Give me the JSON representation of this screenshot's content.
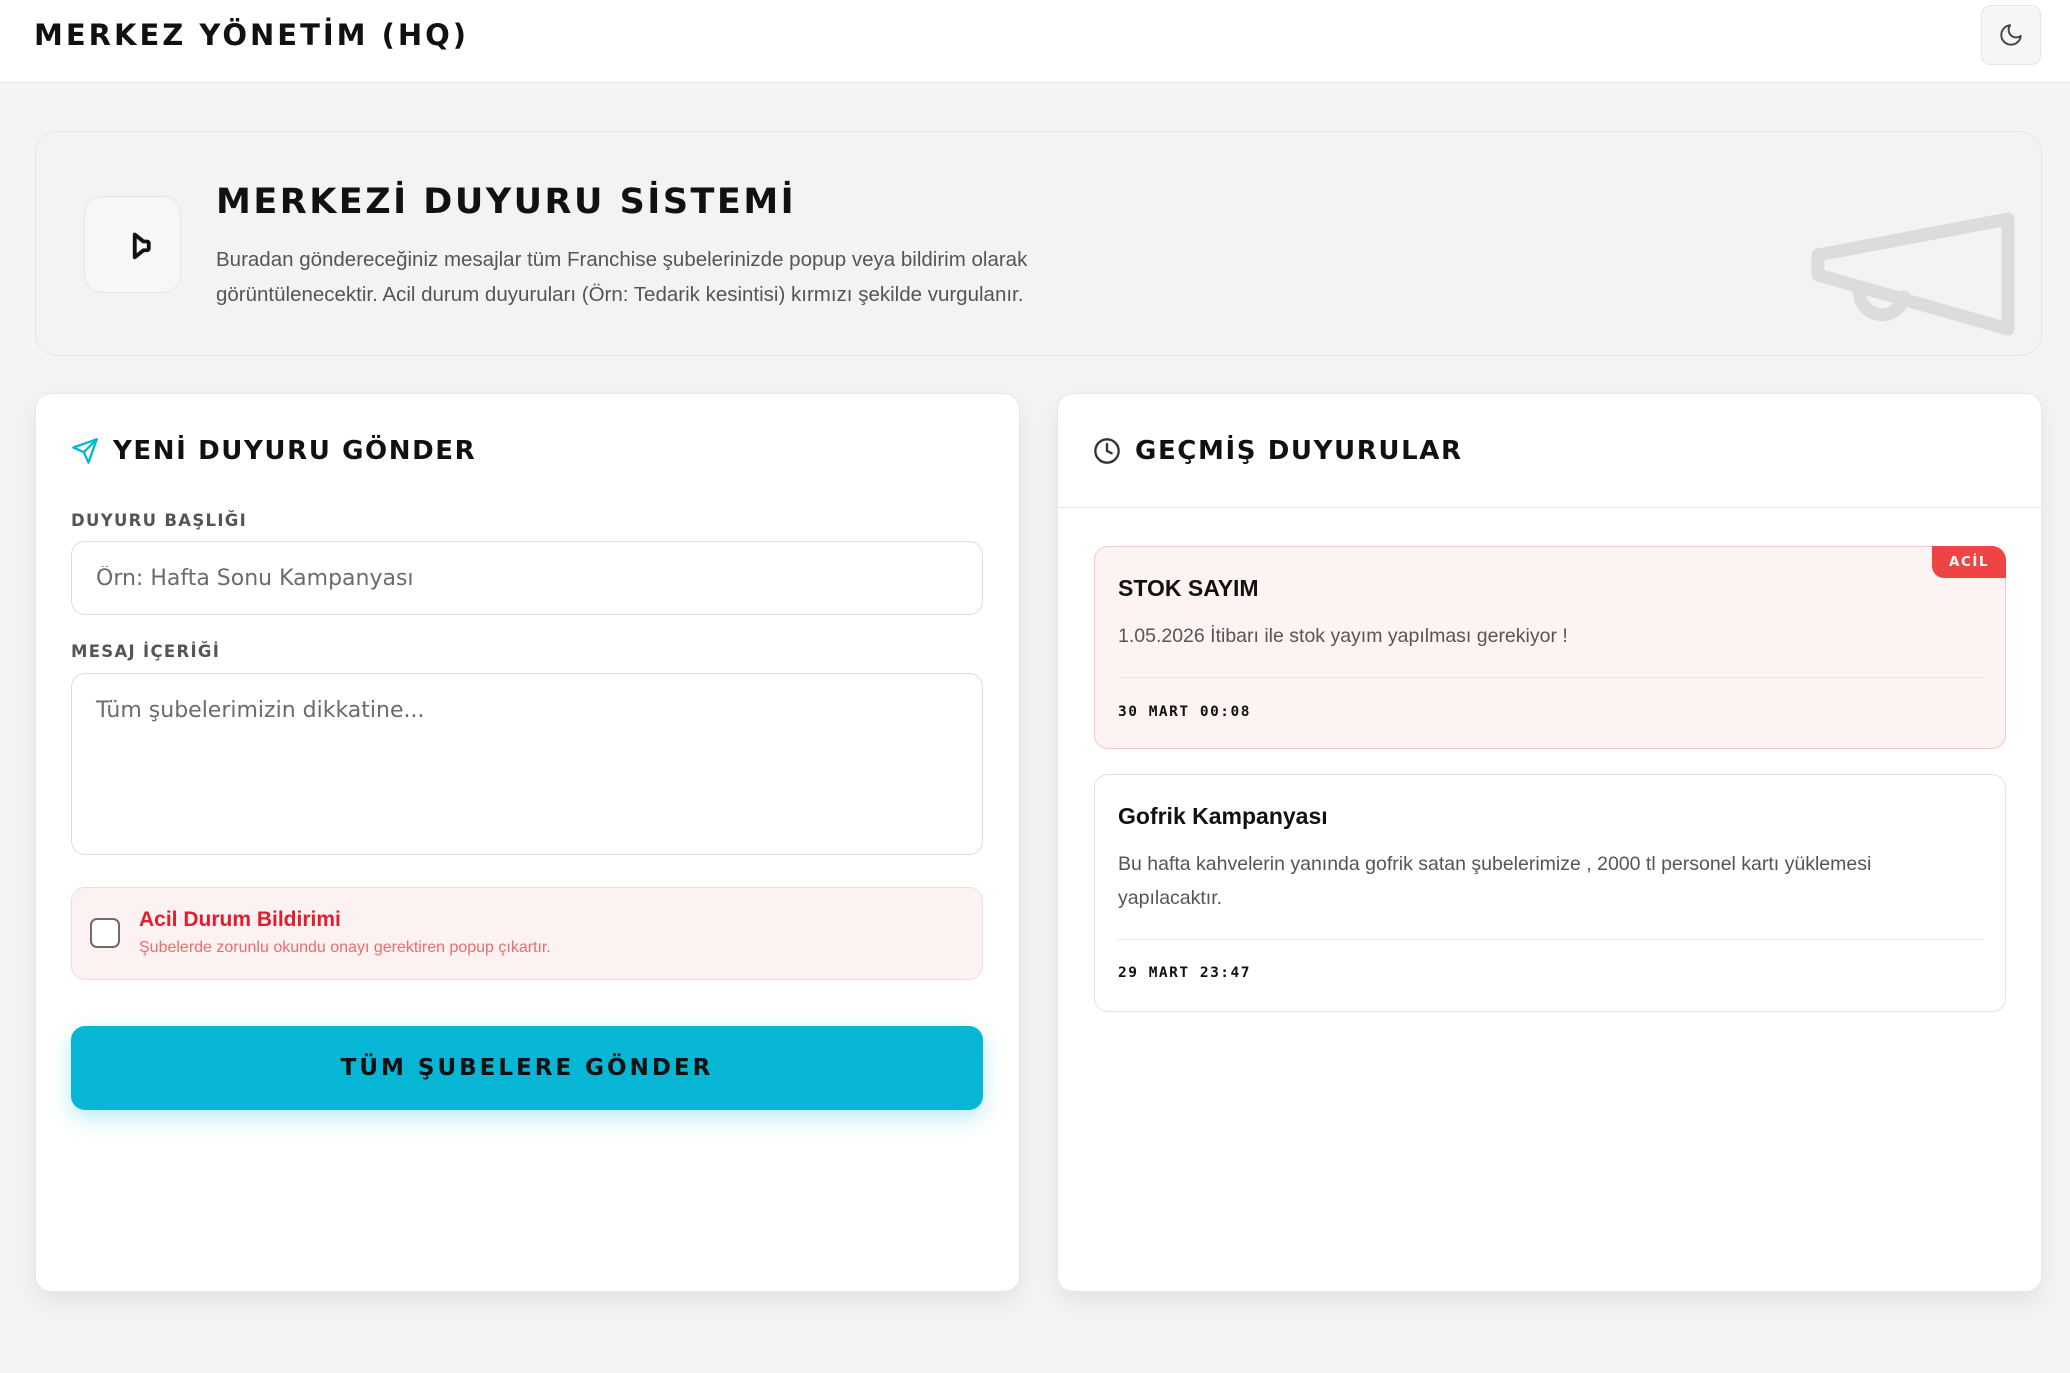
{
  "header": {
    "title": "MERKEZ YÖNETİM (HQ)",
    "theme_toggle_icon": "moon-icon"
  },
  "hero": {
    "icon": "megaphone-icon",
    "title": "MERKEZİ DUYURU SİSTEMİ",
    "description": "Buradan göndereceğiniz mesajlar tüm Franchise şubelerinizde popup veya bildirim olarak görüntülenecektir. Acil durum duyuruları (Örn: Tedarik kesintisi) kırmızı şekilde vurgulanır."
  },
  "form": {
    "title": "YENİ DUYURU GÖNDER",
    "title_icon": "send-icon",
    "subject_label": "DUYURU BAŞLIĞI",
    "subject_placeholder": "Örn: Hafta Sonu Kampanyası",
    "subject_value": "",
    "message_label": "MESAJ İÇERİĞİ",
    "message_placeholder": "Tüm şubelerimizin dikkatine...",
    "message_value": "",
    "urgent": {
      "checked": false,
      "title": "Acil Durum Bildirimi",
      "description": "Şubelerde zorunlu okundu onayı gerektiren popup çıkartır."
    },
    "submit_label": "TÜM ŞUBELERE GÖNDER"
  },
  "history": {
    "title": "GEÇMİŞ DUYURULAR",
    "title_icon": "clock-icon",
    "items": [
      {
        "title": "STOK SAYIM",
        "body": "1.05.2026 İtibarı ile stok yayım yapılması gerekiyor !",
        "date": "30 MART 00:08",
        "urgent": true,
        "badge": "ACİL"
      },
      {
        "title": "Gofrik Kampanyası",
        "body": "Bu hafta kahvelerin yanında gofrik satan şubelerimize , 2000 tl personel kartı yüklemesi yapılacaktır.",
        "date": "29 MART 23:47",
        "urgent": false
      }
    ]
  },
  "colors": {
    "accent": "#06b6d4",
    "urgent": "#ef4444",
    "urgent_bg": "#fdf3f3"
  }
}
